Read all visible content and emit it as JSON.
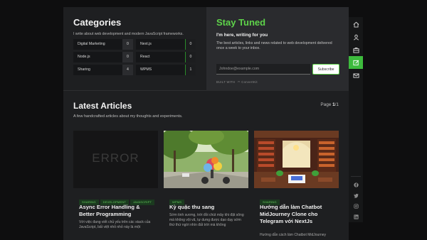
{
  "categories": {
    "title": "Categories",
    "intro": "I write about web development and modern JavaScript frameworks.",
    "items": [
      {
        "name": "Digital Marketing",
        "count": "0"
      },
      {
        "name": "Next.js",
        "count": "0"
      },
      {
        "name": "Node.js",
        "count": "0"
      },
      {
        "name": "React",
        "count": "0"
      },
      {
        "name": "Sharing",
        "count": "4"
      },
      {
        "name": "WPMS",
        "count": "1"
      }
    ]
  },
  "newsletter": {
    "title": "Stay Tuned",
    "subtitle": "I'm here, writing for you",
    "description": "The best articles, links and news related to web development delivered once a week to your inbox.",
    "email_placeholder": "Johndoe@example.com",
    "subscribe_label": "Subscribe",
    "built_with": "BUILT WITH",
    "provider": "ConvertKit"
  },
  "articles": {
    "title": "Latest Articles",
    "intro": "A few handcrafted articles about my thoughts and experiments.",
    "page_label": "Page",
    "page_current": "1",
    "page_total": "/1",
    "cards": [
      {
        "image_text": "ERROR",
        "tags": [
          "SHARING",
          "DEVELOPMENT",
          "JAVASCRIPT"
        ],
        "title": "Async Error Handling & Better Programming",
        "excerpt": "Với việc đang viết chủ yếu trên các stack của JavaScript, bất việt nhỏ nhỏ này là một"
      },
      {
        "tags": [
          "WPMS"
        ],
        "title": "Kỳ quặc thu sang",
        "excerpt": "Sớm tinh sương, trời đồi chút mây khi đặt sông mà không vội vã, tự dưng được dạo dạy sớm thứ thứ ngời nhìn đất trời mà không"
      },
      {
        "tags": [
          "SHARING"
        ],
        "title": "Hướng dẫn làm Chatbot MidJourney Clone cho Telegram với NextJs",
        "excerpt": "Hướng dẫn cách làm Chatbot MidJourney"
      }
    ]
  },
  "sidebar": {
    "nav": [
      "home-icon",
      "user-icon",
      "briefcase-icon",
      "pen-icon",
      "mail-icon"
    ],
    "active_index": 3,
    "social": [
      "facebook-icon",
      "twitter-icon",
      "instagram-icon",
      "linkedin-icon"
    ]
  },
  "colors": {
    "accent": "#5ed34a",
    "panel": "#1e1f21",
    "tag_bg": "#1b3a1f",
    "tag_text": "#62c95a"
  }
}
